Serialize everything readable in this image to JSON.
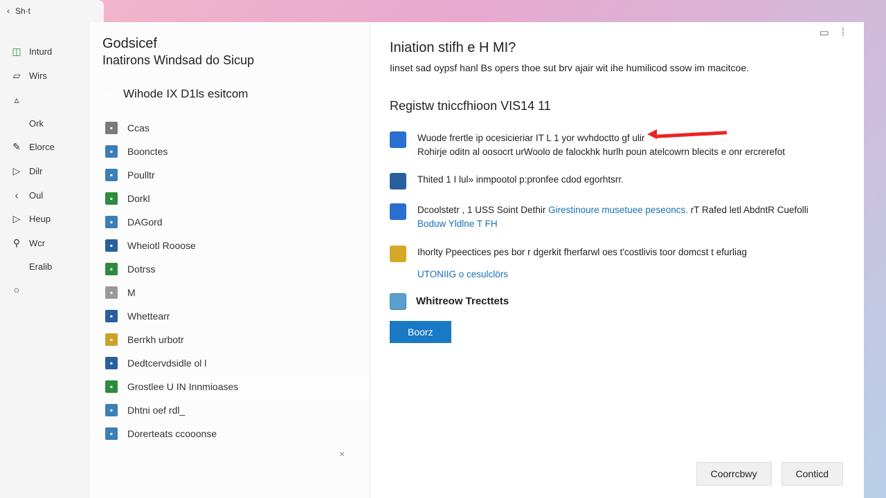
{
  "tab": {
    "back_glyph": "‹",
    "label": "Sh·t"
  },
  "window_controls": {
    "min": "—",
    "max": "▭",
    "search": "○",
    "more": "⁞"
  },
  "leftnav": [
    {
      "icon": "◫",
      "color": "#2e8b3d",
      "label": "Inturd"
    },
    {
      "icon": "▱",
      "color": "#888",
      "label": "Wirs"
    },
    {
      "icon": "▵",
      "color": "#888",
      "label": ""
    },
    {
      "icon": "",
      "color": "",
      "label": "Ork"
    },
    {
      "icon": "✎",
      "color": "#777",
      "label": "Elorce"
    },
    {
      "icon": "▷",
      "color": "#777",
      "label": "Dilr"
    },
    {
      "icon": "‹",
      "color": "#777",
      "label": "Oul"
    },
    {
      "icon": "▷",
      "color": "#777",
      "label": "Heup"
    },
    {
      "icon": "⚲",
      "color": "#777",
      "label": "Wcr"
    },
    {
      "icon": "",
      "color": "",
      "label": "Eralib"
    },
    {
      "icon": "○",
      "color": "#888",
      "label": ""
    }
  ],
  "header": {
    "title": "Godsicef",
    "subtitle": "Inatirons Windsad do Sicup"
  },
  "setup_head": {
    "icon_color": "#4a8c3a",
    "label": "Wihode IX D1ls esitcom"
  },
  "list": [
    {
      "color": "#7a7a7a",
      "label": "Ccas"
    },
    {
      "color": "#3b7fb5",
      "label": "Boonctes"
    },
    {
      "color": "#3b7fb5",
      "label": "Poulltr"
    },
    {
      "color": "#2e8b3d",
      "label": "Dorkl"
    },
    {
      "color": "#3b7fb5",
      "label": "DAGord"
    },
    {
      "color": "#2a5f9e",
      "label": "Wheiotl Rooose"
    },
    {
      "color": "#2e8b3d",
      "label": "Dotrss"
    },
    {
      "color": "#999",
      "label": "M"
    },
    {
      "color": "#2a5f9e",
      "label": "Whettearr"
    },
    {
      "color": "#c9a227",
      "label": "Berrkh urbotr"
    },
    {
      "color": "#2a5f9e",
      "label": "Dedtcervdsidle ol l"
    },
    {
      "color": "#2e8b3d",
      "label": "Grostlee U IN Innmioases"
    },
    {
      "color": "#3b7fb5",
      "label": "Dhtni oef rdl_"
    },
    {
      "color": "#3b7fb5",
      "label": "Dorerteats ccooonse"
    }
  ],
  "close_x": "×",
  "panel": {
    "title": "Iniation stifh e H MI?",
    "desc": "Iinset sad oypsf hanl Bs opers thoe sut brv ajair wit ihe humilicod ssow im macitcoe.",
    "section_title": "Registw tniccfhioon VIS14 11"
  },
  "items": [
    {
      "color": "#2a6fd0",
      "title": "Wuode frertle ip ocesicieriar IT L 1 yor wvhdoctto gf ulir",
      "body": "Rohirje oditn al oosocrt urWoolo de falockhk hurlh poun atelcowrn blecits e onr ercrerefot"
    },
    {
      "color": "#2a5f9e",
      "title": "Thited 1 I lul» inmpootol  p:pronfee cdod egorhtsrr."
    },
    {
      "color": "#2a6fd0",
      "title": "Dcoolstetr , 1 USS Soint Dethir Girestinoure musetuee peseoncs. rT Rafed letl  AbdntR  Cuefolli",
      "link": "Boduw Yldlne T FH"
    },
    {
      "color": "#d6a828",
      "title": "Ihorlty Ppeectices pes bor  r dgerkit fherfarwl oes t'costlivis toor domcst t efurliag"
    }
  ],
  "standalone_link": "UTONIIG o cesulclörs",
  "whrow": {
    "icon_color": "#5aa0cc",
    "label": "Whitreow Trecttets"
  },
  "primary_btn": "Boorz",
  "footer": {
    "continue": "Coorrcbwy",
    "cancel": "Conticd"
  },
  "right_utils": {
    "cal": "▭",
    "more": "⁞"
  }
}
